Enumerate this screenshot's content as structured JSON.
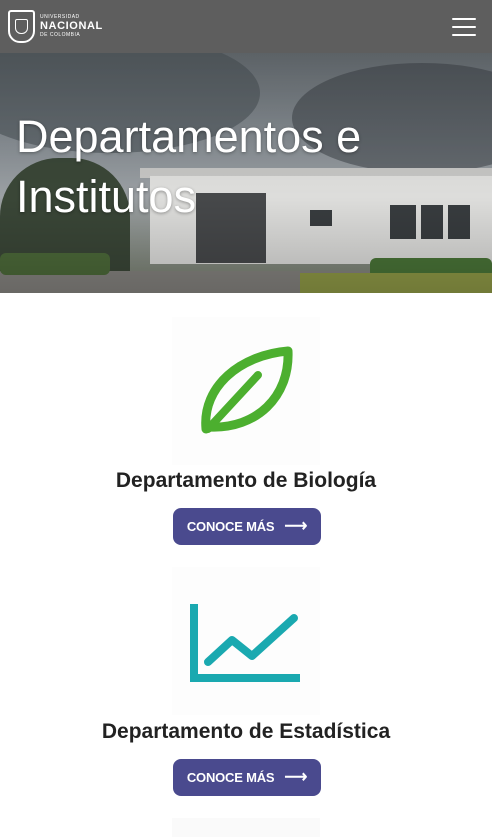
{
  "header": {
    "logo_small_top": "UNIVERSIDAD",
    "logo_name": "NACIONAL",
    "logo_small_bottom": "DE COLOMBIA",
    "menu_icon": "hamburger-icon"
  },
  "hero": {
    "title": "Departamentos e Institutos"
  },
  "cards": [
    {
      "title": "Departamento de Biología",
      "button_label": "CONOCE MÁS",
      "icon": "leaf-icon",
      "icon_color": "#4caf2f"
    },
    {
      "title": "Departamento de Estadística",
      "button_label": "CONOCE MÁS",
      "icon": "trend-chart-icon",
      "icon_color": "#1aa9b0"
    }
  ],
  "colors": {
    "topbar": "#5e5e5e",
    "button": "#4a4a8e"
  }
}
